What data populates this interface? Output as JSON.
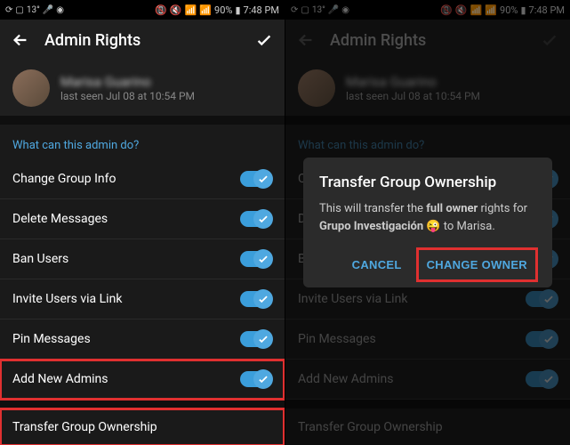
{
  "status": {
    "battery": "90%",
    "time": "7:48 PM",
    "temp": "13°"
  },
  "header": {
    "title": "Admin Rights"
  },
  "user": {
    "name": "Marisa Guarino",
    "status": "last seen Jul 08 at 10:54 PM"
  },
  "section_title": "What can this admin do?",
  "options": [
    {
      "label": "Change Group Info",
      "on": true
    },
    {
      "label": "Delete Messages",
      "on": true
    },
    {
      "label": "Ban Users",
      "on": true
    },
    {
      "label": "Invite Users via Link",
      "on": true
    },
    {
      "label": "Pin Messages",
      "on": true
    },
    {
      "label": "Add New Admins",
      "on": true
    }
  ],
  "transfer_label": "Transfer Group Ownership",
  "dialog": {
    "title": "Transfer Group Ownership",
    "text_pre": "This will transfer the ",
    "text_bold": "full owner",
    "text_mid": " rights for ",
    "group": "Grupo Investigación",
    "emoji": "😜",
    "text_post": " to Marisa.",
    "cancel": "CANCEL",
    "confirm": "CHANGE OWNER"
  }
}
